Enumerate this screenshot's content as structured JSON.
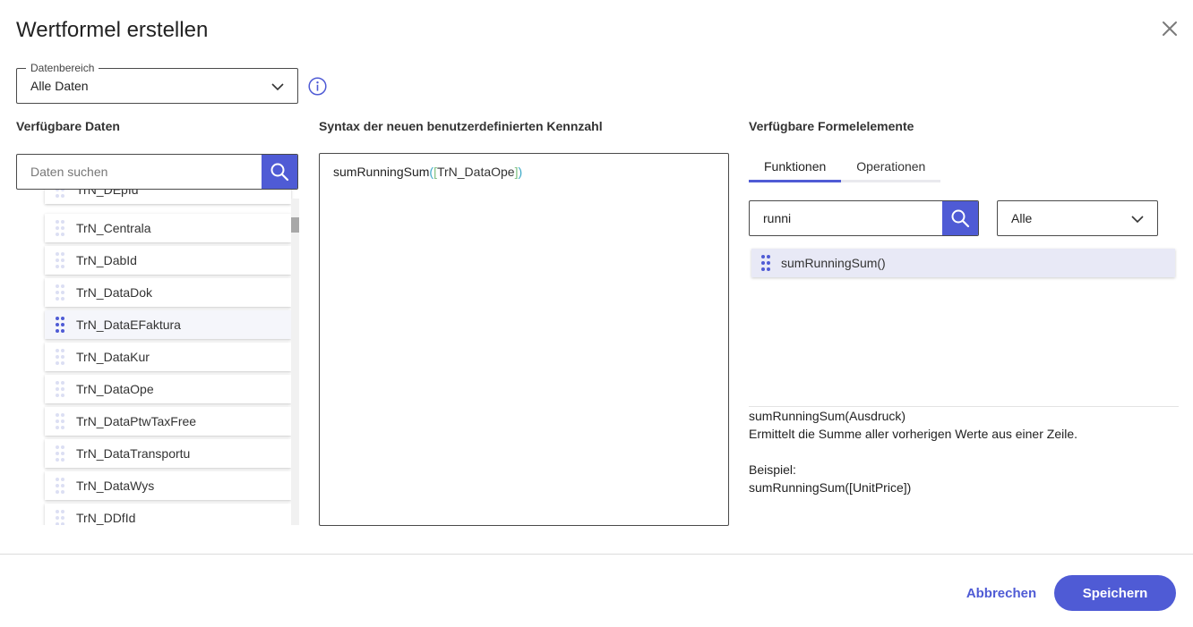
{
  "dialog": {
    "title": "Wertformel erstellen"
  },
  "data_range": {
    "legend": "Datenbereich",
    "value": "Alle Daten"
  },
  "available_data": {
    "heading": "Verfügbare Daten",
    "search_placeholder": "Daten suchen",
    "items": [
      {
        "label": "TrN_DEpId",
        "active": false
      },
      {
        "label": "TrN_Centrala",
        "active": false
      },
      {
        "label": "TrN_DabId",
        "active": false
      },
      {
        "label": "TrN_DataDok",
        "active": false
      },
      {
        "label": "TrN_DataEFaktura",
        "active": true
      },
      {
        "label": "TrN_DataKur",
        "active": false
      },
      {
        "label": "TrN_DataOpe",
        "active": false
      },
      {
        "label": "TrN_DataPtwTaxFree",
        "active": false
      },
      {
        "label": "TrN_DataTransportu",
        "active": false
      },
      {
        "label": "TrN_DataWys",
        "active": false
      },
      {
        "label": "TrN_DDfId",
        "active": false
      }
    ]
  },
  "syntax": {
    "heading": "Syntax der neuen benutzerdefinierten Kennzahl",
    "function": "sumRunningSum",
    "open_paren": "(",
    "open_bracket": "[",
    "field": "TrN_DataOpe",
    "close_bracket": "]",
    "close_paren": ")"
  },
  "formula_elements": {
    "heading": "Verfügbare Formelelemente",
    "tabs": [
      {
        "label": "Funktionen",
        "active": true
      },
      {
        "label": "Operationen",
        "active": false
      }
    ],
    "search_value": "runni",
    "category": "Alle",
    "results": [
      {
        "label": "sumRunningSum()"
      }
    ],
    "description": {
      "signature": "sumRunningSum(Ausdruck)",
      "text": "Ermittelt die Summe aller vorherigen Werte aus einer Zeile.",
      "example_label": "Beispiel:",
      "example": "sumRunningSum([UnitPrice])"
    }
  },
  "footer": {
    "cancel": "Abbrechen",
    "save": "Speichern"
  },
  "colors": {
    "accent": "#4f5bd5",
    "grip_inactive": "#dcdff3",
    "grip_active": "#4f5bd5",
    "syntax_paren": "#3aa8c7",
    "syntax_bracket": "#7bbf7e"
  },
  "icons": {
    "close": "close-icon",
    "chevron": "chevron-down-icon",
    "info": "info-icon",
    "search": "search-icon",
    "grip": "drag-handle-icon"
  }
}
